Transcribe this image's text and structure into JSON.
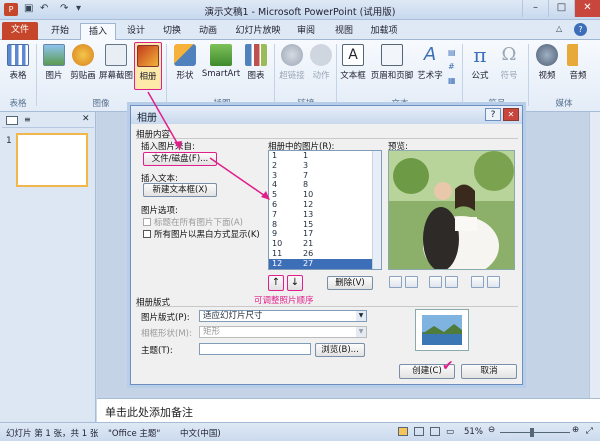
{
  "window": {
    "title": "演示文稿1 - Microsoft PowerPoint (试用版)"
  },
  "tabs": [
    "文件",
    "开始",
    "插入",
    "设计",
    "切换",
    "动画",
    "幻灯片放映",
    "审阅",
    "视图",
    "加载项"
  ],
  "ribbon": {
    "buttons": [
      "表格",
      "图片",
      "剪贴画",
      "屏幕截图",
      "相册",
      "形状",
      "SmartArt",
      "图表",
      "超链接",
      "动作",
      "文本框",
      "页眉和页脚",
      "艺术字",
      "公式",
      "符号",
      "视频",
      "音频"
    ],
    "groups": [
      "表格",
      "图像",
      "插图",
      "链接",
      "文本",
      "符号",
      "媒体"
    ]
  },
  "slide_panel": {
    "slide_number": "1"
  },
  "dialog": {
    "title": "相册",
    "help": "?",
    "close": "✕",
    "album_content_label": "相册内容",
    "insert_from_label": "插入图片来自:",
    "file_disk_button": "文件/磁盘(F)...",
    "insert_text_label": "插入文本:",
    "new_textbox_button": "新建文本框(X)",
    "picture_options_label": "图片选项:",
    "captions_option": "标题在所有图片下面(A)",
    "bw_option": "所有图片以黑白方式显示(K)",
    "pictures_in_album_label": "相册中的图片(R):",
    "pictures": [
      {
        "n": "1",
        "name": "1"
      },
      {
        "n": "2",
        "name": "3"
      },
      {
        "n": "3",
        "name": "7"
      },
      {
        "n": "4",
        "name": "8"
      },
      {
        "n": "5",
        "name": "10"
      },
      {
        "n": "6",
        "name": "12"
      },
      {
        "n": "7",
        "name": "13"
      },
      {
        "n": "8",
        "name": "15"
      },
      {
        "n": "9",
        "name": "17"
      },
      {
        "n": "10",
        "name": "21"
      },
      {
        "n": "11",
        "name": "26"
      },
      {
        "n": "12",
        "name": "27"
      }
    ],
    "preview_label": "预览:",
    "up_arrow": "↑",
    "down_arrow": "↓",
    "delete_button": "删除(V)",
    "album_layout_label": "相册版式",
    "picture_layout_label": "图片版式(P):",
    "picture_layout_value": "适应幻灯片尺寸",
    "frame_shape_label": "相框形状(M):",
    "frame_shape_value": "矩形",
    "theme_label": "主题(T):",
    "theme_value": "",
    "browse_button": "浏览(B)...",
    "create_button": "创建(C)",
    "cancel_button": "取消"
  },
  "annotation": {
    "text": "可调整照片顺序"
  },
  "notes": {
    "placeholder": "单击此处添加备注"
  },
  "statusbar": {
    "slide_info": "幻灯片 第 1 张，共 1 张",
    "theme": "\"Office 主题\"",
    "language": "中文(中国)",
    "zoom": "51%"
  },
  "colors": {
    "accent": "#e0208a",
    "file_tab": "#c5462b",
    "selection": "#3d6fb8"
  }
}
